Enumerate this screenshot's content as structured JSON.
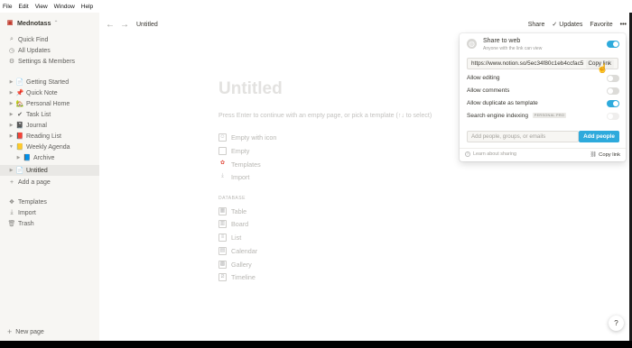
{
  "menubar": [
    "File",
    "Edit",
    "View",
    "Window",
    "Help"
  ],
  "workspace": {
    "name": "Mednotass",
    "icon": "notion-logo-icon"
  },
  "sidebar": {
    "top": [
      {
        "label": "Quick Find",
        "icon": "search-icon"
      },
      {
        "label": "All Updates",
        "icon": "clock-icon"
      },
      {
        "label": "Settings & Members",
        "icon": "gear-icon"
      }
    ],
    "pages": [
      {
        "label": "Getting Started",
        "emoji": "📄"
      },
      {
        "label": "Quick Note",
        "emoji": "📌"
      },
      {
        "label": "Personal Home",
        "emoji": "🏡"
      },
      {
        "label": "Task List",
        "emoji": "✔"
      },
      {
        "label": "Journal",
        "emoji": "📓"
      },
      {
        "label": "Reading List",
        "emoji": "📕"
      },
      {
        "label": "Weekly Agenda",
        "emoji": "📒"
      },
      {
        "label": "Archive",
        "emoji": "📘"
      },
      {
        "label": "Untitled",
        "emoji": "📄"
      },
      {
        "label": "Add a page",
        "emoji": "+"
      }
    ],
    "bottom": [
      {
        "label": "Templates",
        "icon": "templates-icon"
      },
      {
        "label": "Import",
        "icon": "import-icon"
      },
      {
        "label": "Trash",
        "icon": "trash-icon"
      }
    ],
    "new_page": "New page"
  },
  "topbar": {
    "breadcrumb": "Untitled",
    "share": "Share",
    "updates": "Updates",
    "favorite": "Favorite",
    "more": "•••"
  },
  "page": {
    "title": "Untitled",
    "hint": "Press Enter to continue with an empty page, or pick a template (↑↓ to select)",
    "options": [
      {
        "label": "Empty with icon"
      },
      {
        "label": "Empty"
      },
      {
        "label": "Templates"
      },
      {
        "label": "Import"
      }
    ],
    "database_label": "DATABASE",
    "database_options": [
      {
        "label": "Table"
      },
      {
        "label": "Board"
      },
      {
        "label": "List"
      },
      {
        "label": "Calendar"
      },
      {
        "label": "Gallery"
      },
      {
        "label": "Timeline"
      }
    ]
  },
  "share_popup": {
    "title": "Share to web",
    "subtitle": "Anyone with the link can view",
    "url": "https://www.notion.so/5ec34f80c1eb4ccfac5",
    "copy_link": "Copy link",
    "permissions": [
      {
        "label": "Allow editing",
        "on": false
      },
      {
        "label": "Allow comments",
        "on": false
      },
      {
        "label": "Allow duplicate as template",
        "on": true
      },
      {
        "label": "Search engine indexing",
        "on": false,
        "badge": "PERSONAL PRO"
      }
    ],
    "invite_placeholder": "Add people, groups, or emails",
    "add_people": "Add people",
    "learn": "Learn about sharing",
    "copy_link_footer": "Copy link",
    "accent": "#2eaadc"
  },
  "help": "?"
}
